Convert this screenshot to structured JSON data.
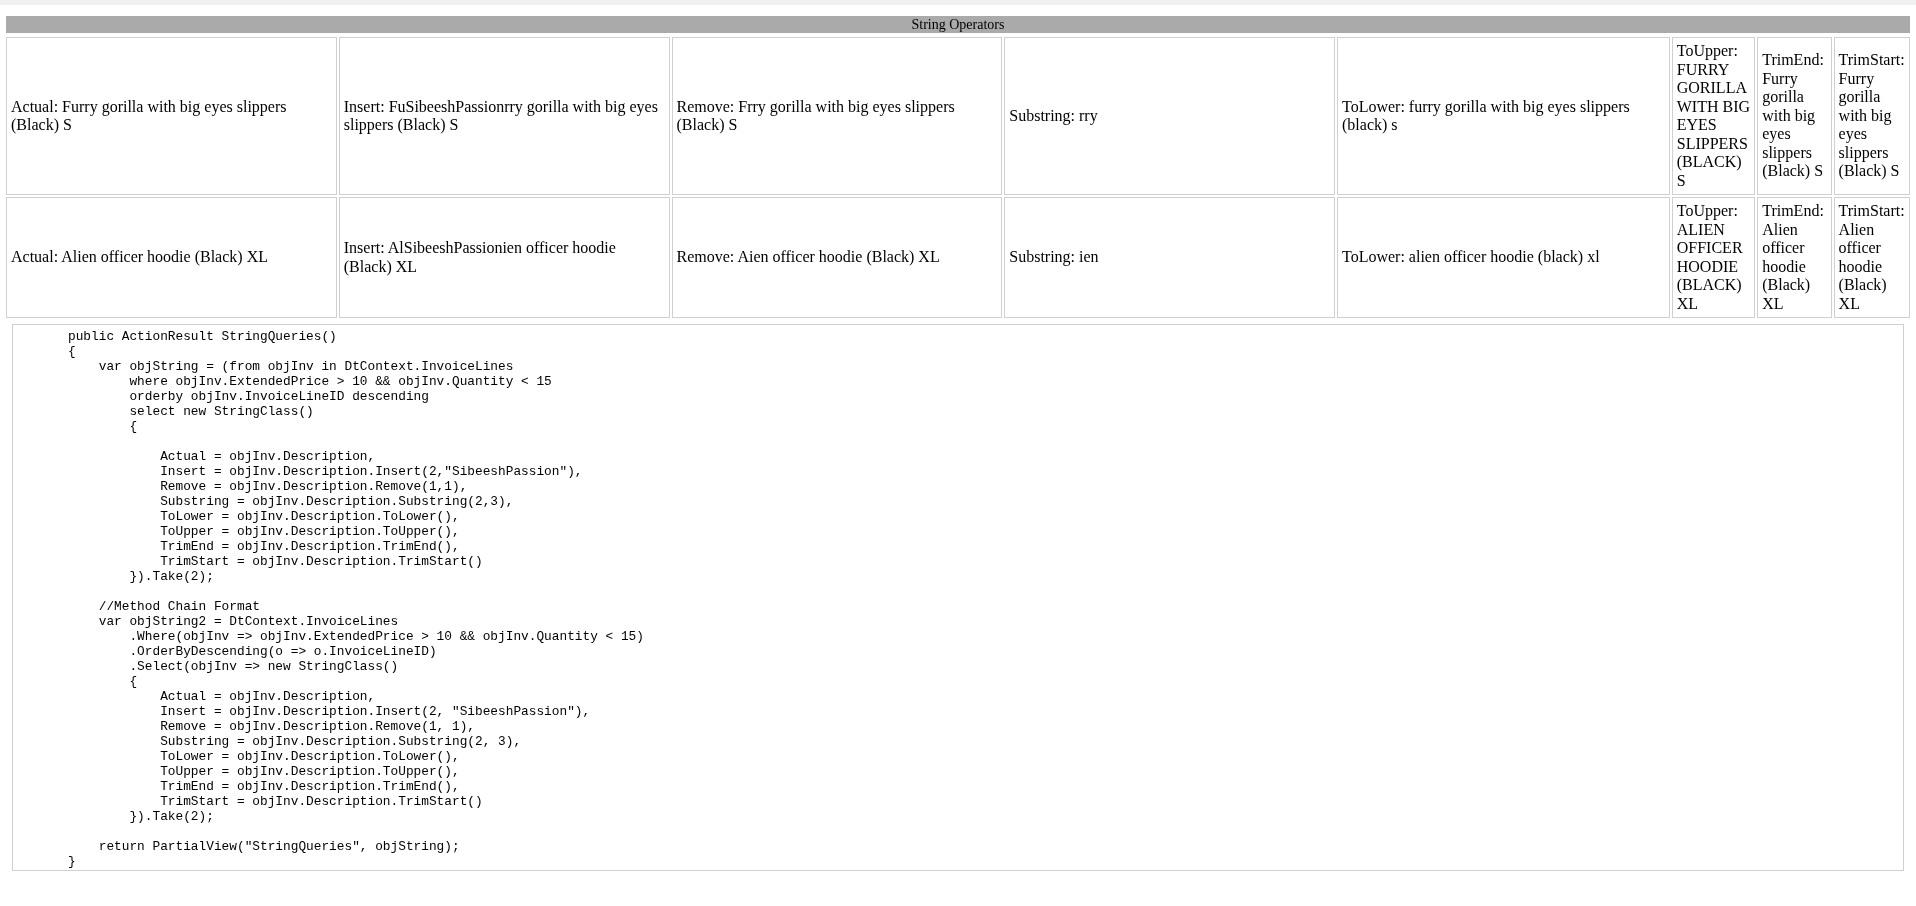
{
  "title": "String Operators",
  "rows": [
    {
      "cells": [
        "Actual: Furry gorilla with big eyes slippers (Black) S",
        "Insert: FuSibeeshPassionrry gorilla with big eyes slippers (Black) S",
        "Remove: Frry gorilla with big eyes slippers (Black) S",
        "Substring: rry",
        "ToLower: furry gorilla with big eyes slippers (black) s",
        "ToUpper: FURRY GORILLA WITH BIG EYES SLIPPERS (BLACK) S",
        "TrimEnd: Furry gorilla with big eyes slippers (Black) S",
        "TrimStart: Furry gorilla with big eyes slippers (Black) S"
      ]
    },
    {
      "cells": [
        "Actual: Alien officer hoodie (Black) XL",
        "Insert: AlSibeeshPassionien officer hoodie (Black) XL",
        "Remove: Aien officer hoodie (Black) XL",
        "Substring: ien",
        "ToLower: alien officer hoodie (black) xl",
        "ToUpper: ALIEN OFFICER HOODIE (BLACK) XL",
        "TrimEnd: Alien officer hoodie (Black) XL",
        "TrimStart: Alien officer hoodie (Black) XL"
      ]
    }
  ],
  "code": "public ActionResult StringQueries()\n{\n    var objString = (from objInv in DtContext.InvoiceLines\n        where objInv.ExtendedPrice > 10 && objInv.Quantity < 15\n        orderby objInv.InvoiceLineID descending\n        select new StringClass()\n        {\n\n            Actual = objInv.Description,\n            Insert = objInv.Description.Insert(2,\"SibeeshPassion\"),\n            Remove = objInv.Description.Remove(1,1),\n            Substring = objInv.Description.Substring(2,3),\n            ToLower = objInv.Description.ToLower(),\n            ToUpper = objInv.Description.ToUpper(),\n            TrimEnd = objInv.Description.TrimEnd(),\n            TrimStart = objInv.Description.TrimStart()\n        }).Take(2);\n\n    //Method Chain Format\n    var objString2 = DtContext.InvoiceLines\n        .Where(objInv => objInv.ExtendedPrice > 10 && objInv.Quantity < 15)\n        .OrderByDescending(o => o.InvoiceLineID)\n        .Select(objInv => new StringClass()\n        {\n            Actual = objInv.Description,\n            Insert = objInv.Description.Insert(2, \"SibeeshPassion\"),\n            Remove = objInv.Description.Remove(1, 1),\n            Substring = objInv.Description.Substring(2, 3),\n            ToLower = objInv.Description.ToLower(),\n            ToUpper = objInv.Description.ToUpper(),\n            TrimEnd = objInv.Description.TrimEnd(),\n            TrimStart = objInv.Description.TrimStart()\n        }).Take(2);\n\n    return PartialView(\"StringQueries\", objString);\n}"
}
